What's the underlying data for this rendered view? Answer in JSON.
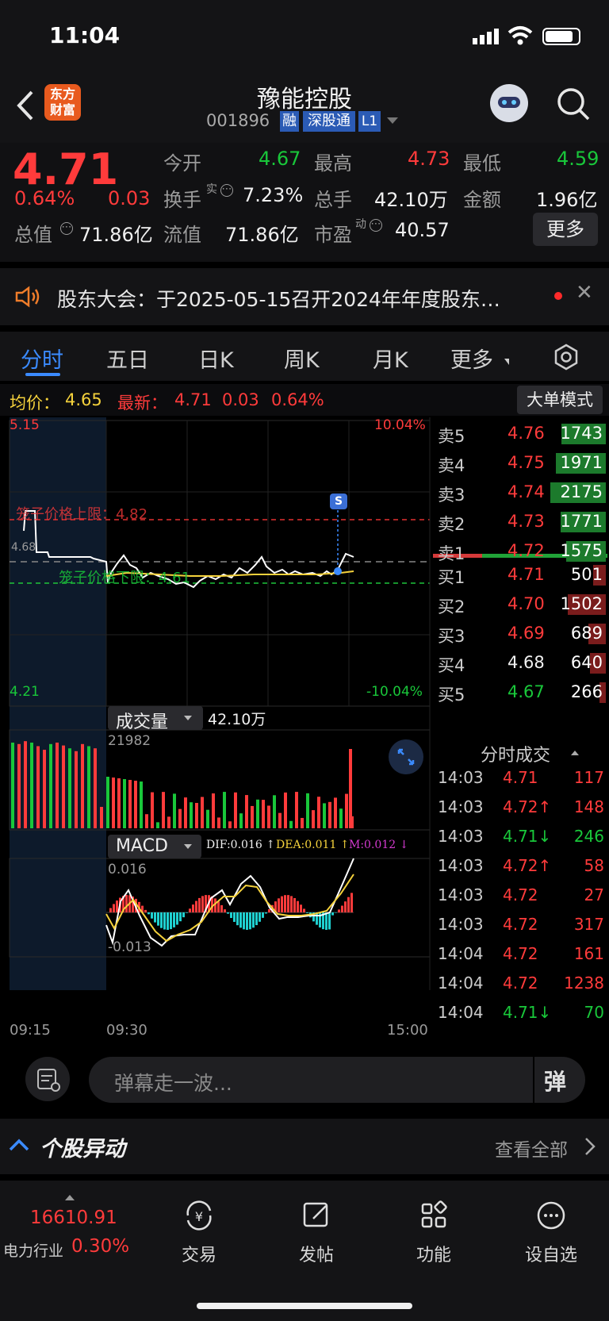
{
  "status_bar": {
    "time": "11:04"
  },
  "header": {
    "title": "豫能控股",
    "code": "001896",
    "badges": [
      "融",
      "深股通",
      "L1"
    ],
    "logo_line1": "东方",
    "logo_line2": "财富"
  },
  "quote": {
    "price": "4.71",
    "pct": "0.64%",
    "change": "0.03",
    "open_label": "今开",
    "open": "4.67",
    "high_label": "最高",
    "high": "4.73",
    "low_label": "最低",
    "low": "4.59",
    "turnover_label": "换手",
    "turnover_sup": "实",
    "turnover": "7.23%",
    "volume_label": "总手",
    "volume": "42.10万",
    "amount_label": "金额",
    "amount": "1.96亿",
    "mcap_label": "总值",
    "mcap": "71.86亿",
    "float_label": "流值",
    "float": "71.86亿",
    "pe_label": "市盈",
    "pe_sup": "动",
    "pe": "40.57",
    "more_button": "更多"
  },
  "notice": {
    "text": "股东大会：于2025-05-15召开2024年年度股东…"
  },
  "tabs": [
    "分时",
    "五日",
    "日K",
    "周K",
    "月K",
    "更多"
  ],
  "infobar": {
    "avg_label": "均价：",
    "avg": "4.65",
    "latest_label": "最新：",
    "latest": "4.71",
    "latest_chg": "0.03",
    "latest_pct": "0.64%",
    "big_order_button": "大单模式"
  },
  "price_chart": {
    "top_price": "5.15",
    "bottom_price": "4.21",
    "top_pct": "10.04%",
    "bottom_pct": "-10.04%",
    "upper_limit_label": "笼子价格上限：4.82",
    "lower_limit_label": "笼子价格下限：4.61",
    "prev_close_label": "4.68",
    "signal_badge": "S"
  },
  "volume_chart": {
    "selector": "成交量",
    "total": "42.10万",
    "peak_label": "21982"
  },
  "macd_chart": {
    "selector": "MACD",
    "dif": "DIF:0.016",
    "dea": "DEA:0.011",
    "m": "M:0.012",
    "top_label": "0.016",
    "bottom_label": "-0.013"
  },
  "time_axis": {
    "start": "09:15",
    "open": "09:30",
    "end": "15:00"
  },
  "order_book": {
    "asks": [
      {
        "label": "卖5",
        "price": "4.76",
        "vol": "1743",
        "bar": 0.8
      },
      {
        "label": "卖4",
        "price": "4.75",
        "vol": "1971",
        "bar": 0.9
      },
      {
        "label": "卖3",
        "price": "4.74",
        "vol": "2175",
        "bar": 1.0
      },
      {
        "label": "卖2",
        "price": "4.73",
        "vol": "1771",
        "bar": 0.81
      },
      {
        "label": "卖1",
        "price": "4.72",
        "vol": "1575",
        "bar": 0.72
      }
    ],
    "bids": [
      {
        "label": "买1",
        "price": "4.71",
        "vol": "501",
        "bar": 0.23,
        "color": "red"
      },
      {
        "label": "买2",
        "price": "4.70",
        "vol": "1502",
        "bar": 0.69,
        "color": "red"
      },
      {
        "label": "买3",
        "price": "4.69",
        "vol": "689",
        "bar": 0.32,
        "color": "red"
      },
      {
        "label": "买4",
        "price": "4.68",
        "vol": "640",
        "bar": 0.29,
        "color": "white"
      },
      {
        "label": "买5",
        "price": "4.67",
        "vol": "266",
        "bar": 0.12,
        "color": "green"
      }
    ]
  },
  "trades": {
    "title": "分时成交",
    "rows": [
      {
        "time": "14:03",
        "price": "4.71",
        "arrow": "",
        "vol": "117",
        "color": "red"
      },
      {
        "time": "14:03",
        "price": "4.72",
        "arrow": "↑",
        "vol": "148",
        "color": "red"
      },
      {
        "time": "14:03",
        "price": "4.71",
        "arrow": "↓",
        "vol": "246",
        "color": "green"
      },
      {
        "time": "14:03",
        "price": "4.72",
        "arrow": "↑",
        "vol": "58",
        "color": "red"
      },
      {
        "time": "14:03",
        "price": "4.72",
        "arrow": "",
        "vol": "27",
        "color": "red"
      },
      {
        "time": "14:03",
        "price": "4.72",
        "arrow": "",
        "vol": "317",
        "color": "red"
      },
      {
        "time": "14:04",
        "price": "4.72",
        "arrow": "",
        "vol": "161",
        "color": "red"
      },
      {
        "time": "14:04",
        "price": "4.72",
        "arrow": "",
        "vol": "1238",
        "color": "red"
      },
      {
        "time": "14:04",
        "price": "4.71",
        "arrow": "↓",
        "vol": "70",
        "color": "green"
      }
    ]
  },
  "danmu": {
    "placeholder": "弹幕走一波...",
    "button": "弹"
  },
  "movers": {
    "title": "个股异动",
    "view_all": "查看全部"
  },
  "bottom_nav": {
    "index_value": "16610.91",
    "index_name": "电力行业",
    "index_pct": "0.30%",
    "items": [
      "交易",
      "发帖",
      "功能",
      "设自选"
    ]
  },
  "colors": {
    "up": "#ff3b3b",
    "down": "#19c73a",
    "avg": "#f5d23c",
    "accent": "#3b8bff"
  }
}
